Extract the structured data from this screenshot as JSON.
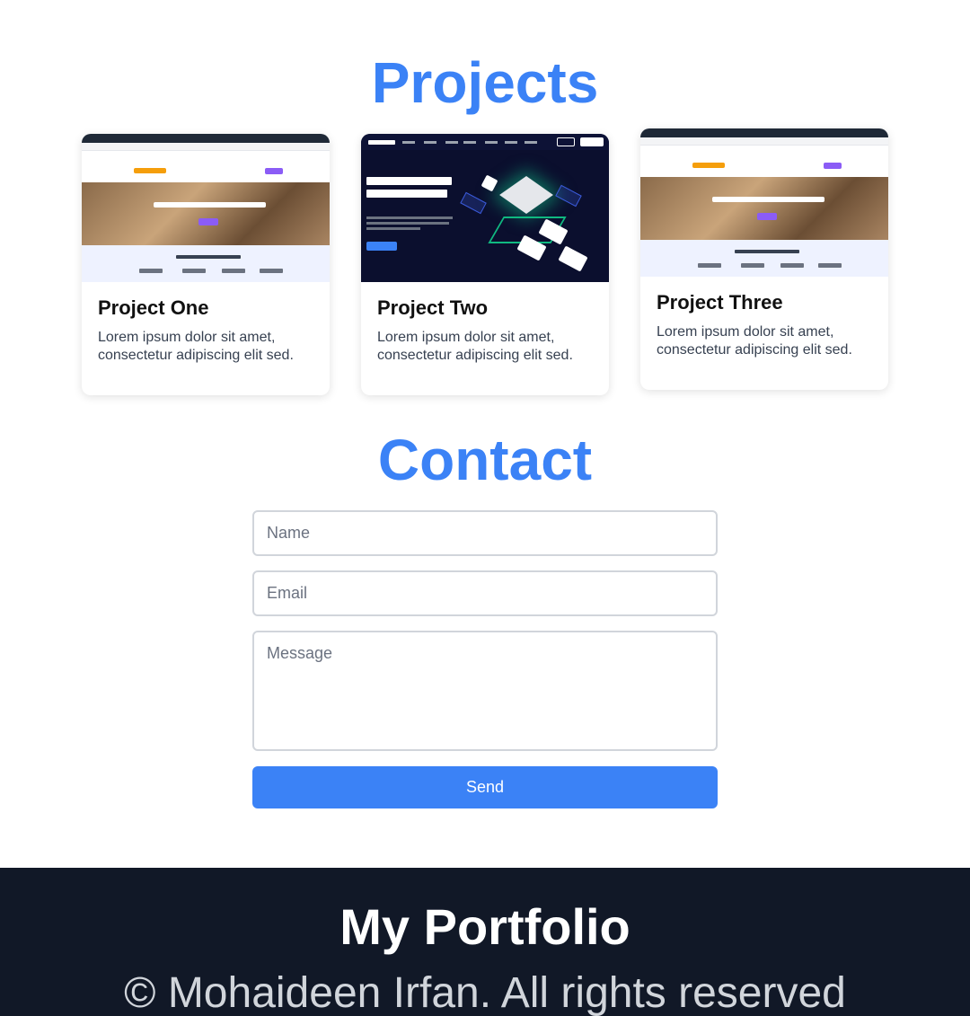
{
  "projects": {
    "title": "Projects",
    "items": [
      {
        "title": "Project One",
        "description": "Lorem ipsum dolor sit amet, consectetur adipiscing elit sed."
      },
      {
        "title": "Project Two",
        "description": "Lorem ipsum dolor sit amet, consectetur adipiscing elit sed."
      },
      {
        "title": "Project Three",
        "description": "Lorem ipsum dolor sit amet, consectetur adipiscing elit sed."
      }
    ]
  },
  "contact": {
    "title": "Contact",
    "name_placeholder": "Name",
    "email_placeholder": "Email",
    "message_placeholder": "Message",
    "send_label": "Send"
  },
  "footer": {
    "title": "My Portfolio",
    "copyright": "© Mohaideen Irfan. All rights reserved"
  },
  "colors": {
    "accent": "#3b82f6",
    "footer_bg": "#111827"
  }
}
